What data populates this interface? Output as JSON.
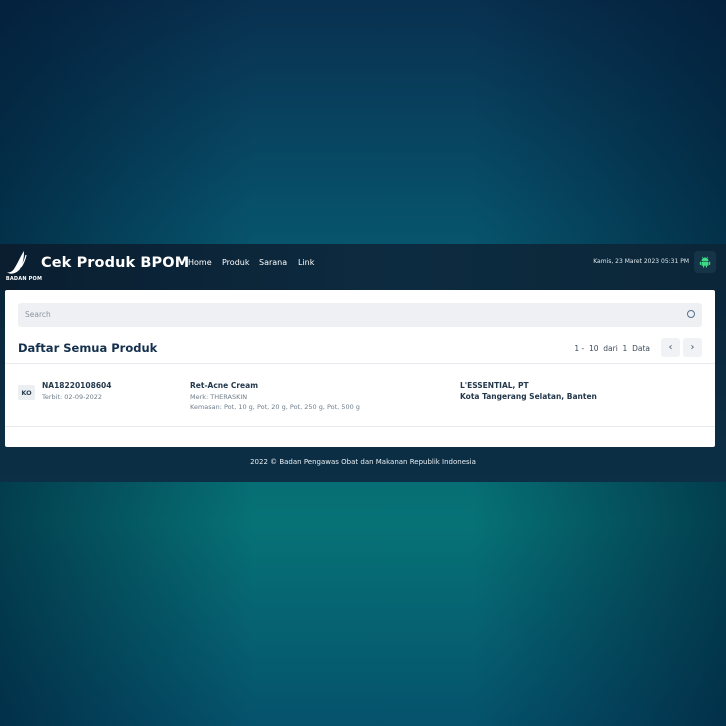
{
  "header": {
    "logo_text": "BADAN POM",
    "brand": "Cek Produk BPOM",
    "menu": [
      "Home",
      "Produk",
      "Sarana",
      "Link"
    ],
    "datetime": "Kamis, 23 Maret 2023 05:31 PM",
    "android_icon": "android-icon"
  },
  "search": {
    "placeholder": "Search"
  },
  "list": {
    "title": "Daftar Semua Produk",
    "pagination": "1 -  10  dari  1  Data",
    "prev_icon": "‹",
    "next_icon": "›"
  },
  "product": {
    "badge": "KO",
    "reg_number": "NA18220108604",
    "issued": "Terbit: 02-09-2022",
    "name": "Ret-Acne Cream",
    "brand": "Merk: THERASKIN",
    "packaging": "Kemasan: Pot, 10 g, Pot, 20 g, Pot, 250 g, Pot, 500 g",
    "company": "L'ESSENTIAL, PT",
    "location": "Kota Tangerang Selatan, Banten"
  },
  "footer": {
    "text": "2022 ©  Badan Pengawas Obat dan Makanan Republik Indonesia"
  },
  "colors": {
    "accent": "#14304d",
    "android": "#3ddc84",
    "navbar": "#0d2b40"
  }
}
